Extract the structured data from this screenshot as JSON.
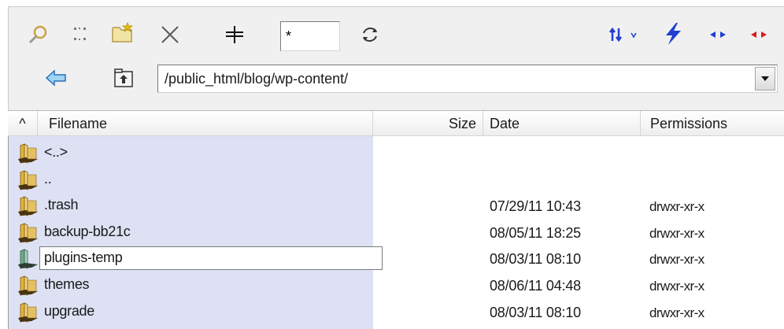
{
  "toolbar": {
    "filter_value": "*",
    "icons": [
      "search-icon",
      "select-icon",
      "new-folder-icon",
      "delete-icon",
      "add-icon",
      "refresh-icon",
      "sort-icon",
      "bolt-icon",
      "blue-arrows-icon",
      "red-arrows-icon"
    ]
  },
  "nav": {
    "path": "/public_html/blog/wp-content/",
    "icons": [
      "back-arrow-icon",
      "parent-folder-icon",
      "dropdown-arrow-icon"
    ]
  },
  "columns": {
    "sort_indicator": "^",
    "filename": "Filename",
    "size": "Size",
    "date": "Date",
    "permissions": "Permissions"
  },
  "files": [
    {
      "name": "<..>",
      "date": "",
      "perm": "",
      "editing": false
    },
    {
      "name": "..",
      "date": "",
      "perm": "",
      "editing": false
    },
    {
      "name": ".trash",
      "date": "07/29/11  10:43",
      "perm": "drwxr-xr-x",
      "editing": false
    },
    {
      "name": "backup-bb21c",
      "date": "08/05/11  18:25",
      "perm": "drwxr-xr-x",
      "editing": false
    },
    {
      "name": "plugins-temp",
      "date": "08/03/11  08:10",
      "perm": "drwxr-xr-x",
      "editing": true
    },
    {
      "name": "themes",
      "date": "08/06/11  04:48",
      "perm": "drwxr-xr-x",
      "editing": false
    },
    {
      "name": "upgrade",
      "date": "08/03/11  08:10",
      "perm": "drwxr-xr-x",
      "editing": false
    }
  ],
  "colors": {
    "list_highlight": "#dde1f3",
    "toolbar_bg": "#f0f0f0",
    "folder": "#e2b43a",
    "accent_blue": "#1f3fd1",
    "accent_red": "#d81b1b"
  }
}
